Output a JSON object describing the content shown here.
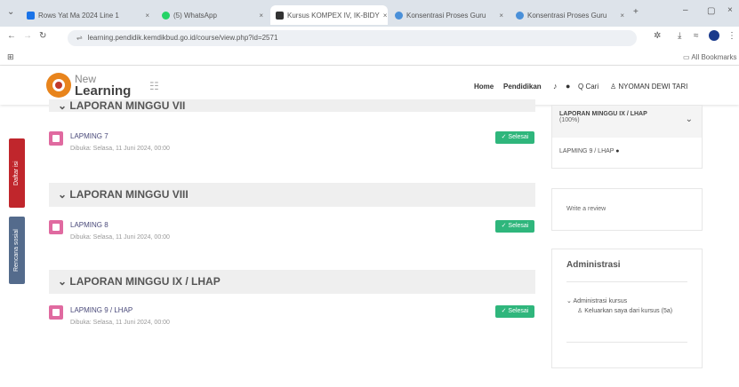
{
  "browser": {
    "tabs": [
      {
        "label": "Rows Yat Ma 2024 Line 1",
        "color": "#1a73e8"
      },
      {
        "label": "(5) WhatsApp",
        "color": "#25d366"
      },
      {
        "label": "Kursus KOMPEX IV, IK-BIDY",
        "color": "#333333"
      },
      {
        "label": "Konsentrasi Proses Guru",
        "color": "#4a90d9"
      },
      {
        "label": "Konsentrasi Proses Guru",
        "color": "#4a90d9"
      }
    ],
    "url": "learning.pendidik.kemdikbud.go.id/course/view.php?id=2571",
    "bookmarks_label": "All Bookmarks"
  },
  "header": {
    "brand_top": "New",
    "brand_bottom": "Learning",
    "nav": [
      "Home",
      "Pendidikan"
    ],
    "search_label": "Q Cari",
    "user_label": "NYOMAN DEWI TARI"
  },
  "left_tabs": {
    "first": "Daftar isi",
    "second": "Rencana sosial"
  },
  "sections": [
    {
      "title": "LAPORAN MINGGU VII",
      "activity": "LAPMING 7",
      "date": "Dibuka: Selasa, 11 Juni 2024, 00:00",
      "status": "✓ Selesai"
    },
    {
      "title": "LAPORAN MINGGU VIII",
      "activity": "LAPMING 8",
      "date": "Dibuka: Selasa, 11 Juni 2024, 00:00",
      "status": "✓ Selesai"
    },
    {
      "title": "LAPORAN MINGGU IX / LHAP",
      "activity": "LAPMING 9 / LHAP",
      "date": "Dibuka: Selasa, 11 Juni 2024, 00:00",
      "status": "✓ Selesai"
    }
  ],
  "sidebar": {
    "nav_block": {
      "title": "LAPORAN MINGGU IX / LHAP",
      "percent": "(100%)",
      "item": "LAPMING 9 / LHAP"
    },
    "review_block": {
      "label": "Write a review"
    },
    "admin_block": {
      "title": "Administrasi",
      "group": "Administrasi kursus",
      "item": "Keluarkan saya dari kursus (5a)"
    }
  },
  "colors": {
    "accent": "#e8841c",
    "done": "#2fb67c",
    "activity_icon": "#e06aa0",
    "side_tab_red": "#c0262c",
    "side_tab_blue": "#546b8c"
  }
}
